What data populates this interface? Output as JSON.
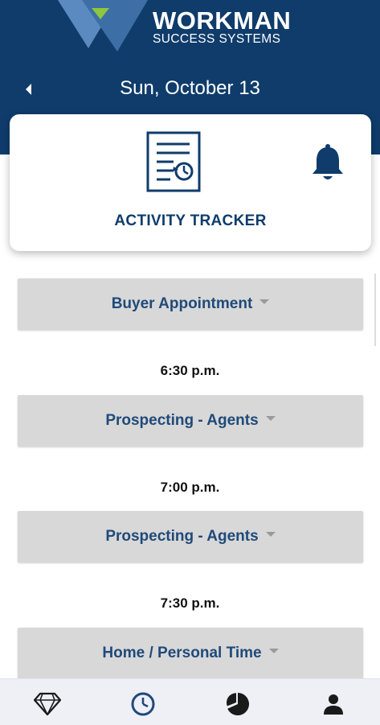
{
  "brand": {
    "line1": "WORKMAN",
    "line2": "SUCCESS SYSTEMS",
    "colors": {
      "navy": "#0f3c6b",
      "triangle_light": "#5b8ac0",
      "triangle_accent": "#8dc63f"
    }
  },
  "header": {
    "back_icon": "chevron-left-icon",
    "date": "Sun, October 13"
  },
  "tracker": {
    "icon": "activity-history-icon",
    "label": "ACTIVITY TRACKER",
    "bell_icon": "bell-icon"
  },
  "activities": [
    {
      "label": "Buyer Appointment"
    },
    {
      "time": "6:30 p.m.",
      "label": "Prospecting - Agents"
    },
    {
      "time": "7:00 p.m.",
      "label": "Prospecting - Agents"
    },
    {
      "time": "7:30 p.m.",
      "label": "Home / Personal Time"
    }
  ],
  "bottom_nav": {
    "items": [
      {
        "icon": "diamond-icon",
        "selected": false
      },
      {
        "icon": "clock-icon",
        "selected": true
      },
      {
        "icon": "pie-chart-icon",
        "selected": false
      },
      {
        "icon": "person-icon",
        "selected": false
      }
    ],
    "colors": {
      "active": "#1f4a7a",
      "inactive": "#1a1a1a"
    }
  }
}
